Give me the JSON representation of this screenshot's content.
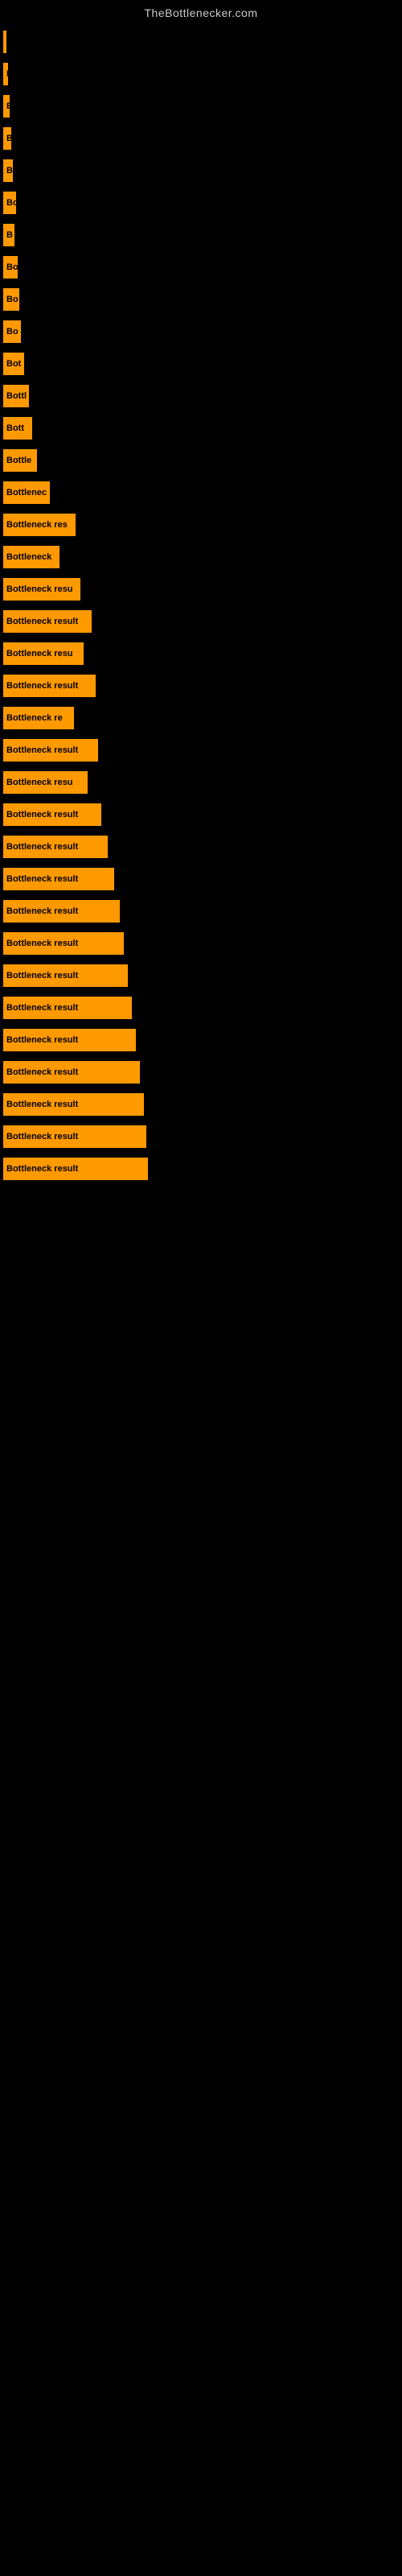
{
  "site": {
    "title": "TheBottlenecker.com"
  },
  "bars": [
    {
      "id": 1,
      "label": "|",
      "width": 4,
      "text": ""
    },
    {
      "id": 2,
      "label": "P",
      "width": 6,
      "text": ""
    },
    {
      "id": 3,
      "label": "E",
      "width": 8,
      "text": ""
    },
    {
      "id": 4,
      "label": "B",
      "width": 10,
      "text": ""
    },
    {
      "id": 5,
      "label": "B",
      "width": 12,
      "text": ""
    },
    {
      "id": 6,
      "label": "Bo",
      "width": 16,
      "text": ""
    },
    {
      "id": 7,
      "label": "B",
      "width": 14,
      "text": ""
    },
    {
      "id": 8,
      "label": "Bo",
      "width": 18,
      "text": ""
    },
    {
      "id": 9,
      "label": "Bo",
      "width": 20,
      "text": ""
    },
    {
      "id": 10,
      "label": "Bo",
      "width": 22,
      "text": ""
    },
    {
      "id": 11,
      "label": "Bot",
      "width": 26,
      "text": ""
    },
    {
      "id": 12,
      "label": "Bottl",
      "width": 32,
      "text": ""
    },
    {
      "id": 13,
      "label": "Bott",
      "width": 36,
      "text": ""
    },
    {
      "id": 14,
      "label": "Bottle",
      "width": 42,
      "text": ""
    },
    {
      "id": 15,
      "label": "Bottlenec",
      "width": 58,
      "text": ""
    },
    {
      "id": 16,
      "label": "Bottleneck res",
      "width": 90,
      "text": ""
    },
    {
      "id": 17,
      "label": "Bottleneck",
      "width": 70,
      "text": ""
    },
    {
      "id": 18,
      "label": "Bottleneck resu",
      "width": 96,
      "text": ""
    },
    {
      "id": 19,
      "label": "Bottleneck result",
      "width": 110,
      "text": ""
    },
    {
      "id": 20,
      "label": "Bottleneck resu",
      "width": 100,
      "text": ""
    },
    {
      "id": 21,
      "label": "Bottleneck result",
      "width": 115,
      "text": ""
    },
    {
      "id": 22,
      "label": "Bottleneck re",
      "width": 88,
      "text": ""
    },
    {
      "id": 23,
      "label": "Bottleneck result",
      "width": 118,
      "text": ""
    },
    {
      "id": 24,
      "label": "Bottleneck resu",
      "width": 105,
      "text": ""
    },
    {
      "id": 25,
      "label": "Bottleneck result",
      "width": 122,
      "text": ""
    },
    {
      "id": 26,
      "label": "Bottleneck result",
      "width": 130,
      "text": ""
    },
    {
      "id": 27,
      "label": "Bottleneck result",
      "width": 138,
      "text": ""
    },
    {
      "id": 28,
      "label": "Bottleneck result",
      "width": 145,
      "text": ""
    },
    {
      "id": 29,
      "label": "Bottleneck result",
      "width": 150,
      "text": ""
    },
    {
      "id": 30,
      "label": "Bottleneck result",
      "width": 155,
      "text": ""
    },
    {
      "id": 31,
      "label": "Bottleneck result",
      "width": 160,
      "text": ""
    },
    {
      "id": 32,
      "label": "Bottleneck result",
      "width": 165,
      "text": ""
    },
    {
      "id": 33,
      "label": "Bottleneck result",
      "width": 170,
      "text": ""
    },
    {
      "id": 34,
      "label": "Bottleneck result",
      "width": 175,
      "text": ""
    },
    {
      "id": 35,
      "label": "Bottleneck result",
      "width": 178,
      "text": ""
    },
    {
      "id": 36,
      "label": "Bottleneck result",
      "width": 180,
      "text": ""
    }
  ]
}
